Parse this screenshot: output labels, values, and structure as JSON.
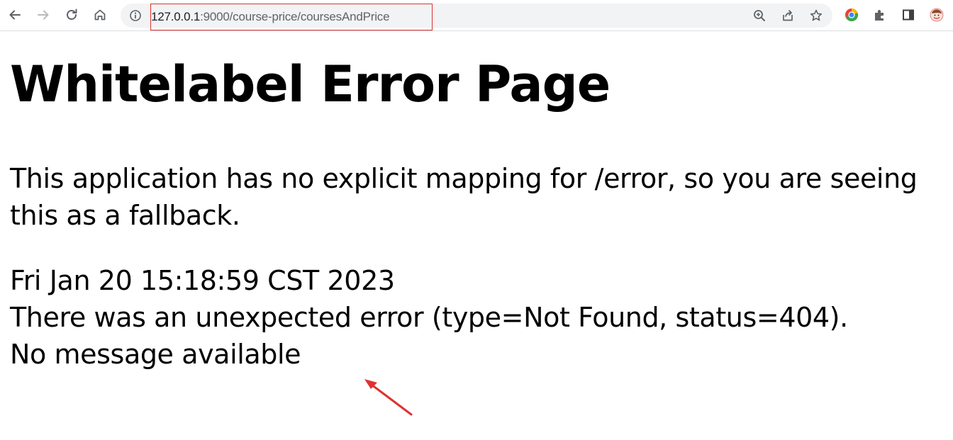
{
  "browser": {
    "url_host": "127.0.0.1",
    "url_path": ":9000/course-price/coursesAndPrice",
    "icons": {
      "back": "arrow-left-icon",
      "forward": "arrow-right-icon",
      "reload": "reload-icon",
      "home": "home-icon",
      "site_info": "info-icon",
      "zoom": "zoom-icon",
      "share": "share-icon",
      "bookmark": "star-icon",
      "extension_chrome": "chrome-logo-icon",
      "extensions": "puzzle-icon",
      "side_panel": "side-panel-icon",
      "profile": "profile-avatar-icon"
    }
  },
  "page": {
    "title": "Whitelabel Error Page",
    "explanation": "This application has no explicit mapping for /error, so you are seeing this as a fallback.",
    "timestamp": "Fri Jan 20 15:18:59 CST 2023",
    "error_line": "There was an unexpected error (type=Not Found, status=404).",
    "message": "No message available"
  },
  "annotation": {
    "highlight_color": "#e03131",
    "arrow_color": "#e03131"
  }
}
